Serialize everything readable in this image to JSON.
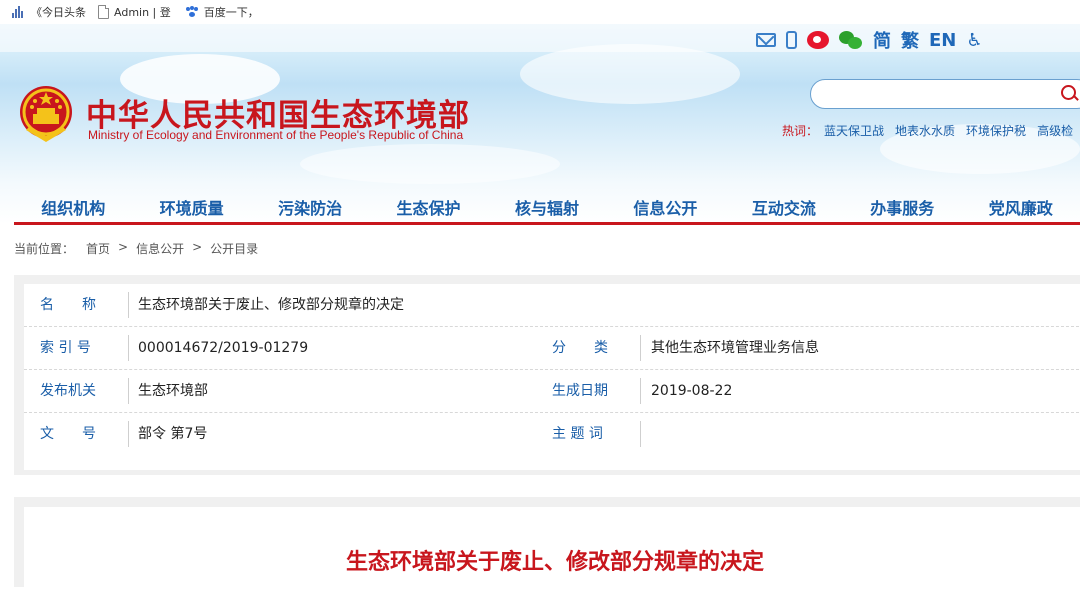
{
  "bookmarks": [
    {
      "label": "《今日头条",
      "icon": "bars-icon"
    },
    {
      "label": "Admin | 登",
      "icon": "document-icon"
    },
    {
      "label": "百度一下，",
      "icon": "baidu-paw-icon"
    }
  ],
  "tools": {
    "lang_simplified": "简",
    "lang_traditional": "繁",
    "lang_english": "EN"
  },
  "site": {
    "title": "中华人民共和国生态环境部",
    "subtitle": "Ministry of Ecology and Environment of the People's Republic of China"
  },
  "search": {
    "placeholder": "",
    "value": ""
  },
  "hot": {
    "label": "热词：",
    "items": [
      "蓝天保卫战",
      "地表水水质",
      "环境保护税",
      "高级检"
    ]
  },
  "nav": [
    "组织机构",
    "环境质量",
    "污染防治",
    "生态保护",
    "核与辐射",
    "信息公开",
    "互动交流",
    "办事服务",
    "党风廉政"
  ],
  "breadcrumb": {
    "label": "当前位置：",
    "items": [
      "首页",
      ">",
      "信息公开",
      ">",
      "公开目录"
    ]
  },
  "info": {
    "name_label": "名　　称",
    "name_value": "生态环境部关于废止、修改部分规章的决定",
    "index_label": "索 引 号",
    "index_value": "000014672/2019-01279",
    "category_label": "分　　类",
    "category_value": "其他生态环境管理业务信息",
    "issuer_label": "发布机关",
    "issuer_value": "生态环境部",
    "date_label": "生成日期",
    "date_value": "2019-08-22",
    "doc_label": "文　　号",
    "doc_value": "部令 第7号",
    "subject_label": "主 题 词",
    "subject_value": ""
  },
  "article": {
    "title": "生态环境部关于废止、修改部分规章的决定"
  },
  "colors": {
    "brand_red": "#c8161d",
    "link_blue": "#1a5ea8"
  }
}
